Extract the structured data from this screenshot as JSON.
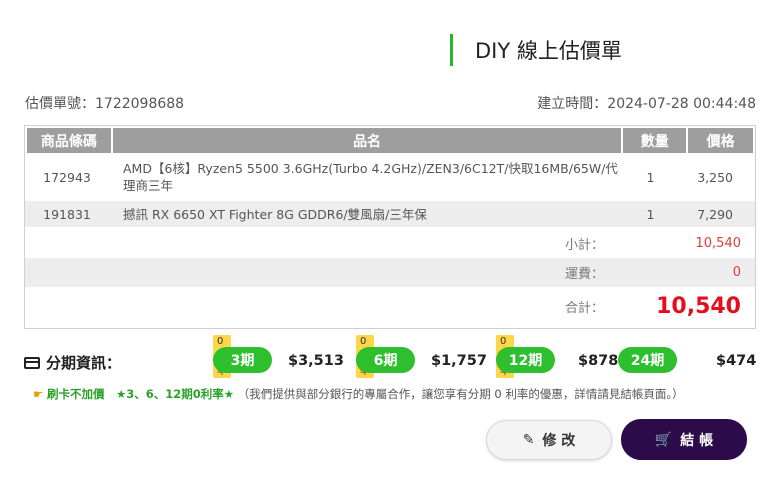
{
  "header": {
    "title": "DIY 線上估價單"
  },
  "meta": {
    "quote_no": "估價單號：1722098688",
    "created": "建立時間：2024-07-28 00:44:48"
  },
  "table": {
    "columns": [
      "商品條碼",
      "品名",
      "數量",
      "價格"
    ],
    "rows": [
      {
        "code": "172943",
        "name": "AMD【6核】Ryzen5 5500 3.6GHz(Turbo 4.2GHz)/ZEN3/6C12T/快取16MB/65W/代理商三年",
        "qty": "1",
        "price": "3,250"
      },
      {
        "code": "191831",
        "name": "撼訊 RX 6650 XT Fighter 8G GDDR6/雙風扇/三年保",
        "qty": "1",
        "price": "7,290"
      }
    ],
    "subtotal_label": "小計：",
    "subtotal": "10,540",
    "shipping_label": "運費：",
    "shipping": "0",
    "total_label": "合計：",
    "total": "10,540"
  },
  "installment": {
    "label": "分期資訊：",
    "plans": [
      {
        "badge": "0利率",
        "period": "3期",
        "amount": "$3,513"
      },
      {
        "badge": "0利率",
        "period": "6期",
        "amount": "$1,757"
      },
      {
        "badge": "0利率",
        "period": "12期",
        "amount": "$878"
      },
      {
        "badge": "",
        "period": "24期",
        "amount": "$474"
      }
    ]
  },
  "promo": {
    "highlight": "刷卡不加價　★3、6、12期0利率★",
    "note": "（我們提供與部分銀行的專屬合作，讓您享有分期 0 利率的優惠，詳情請見結帳頁面。）"
  },
  "buttons": {
    "edit": "修 改",
    "checkout": "結 帳"
  },
  "icons": {
    "card": "credit-card-icon",
    "hand": "pointing-hand-icon",
    "pencil": "pencil-icon",
    "cart": "cart-icon"
  },
  "colors": {
    "accent": "#2db52d",
    "pill": "#2ebf2e",
    "total_red": "#e3101b",
    "checkout_bg": "#2d0b4a"
  }
}
